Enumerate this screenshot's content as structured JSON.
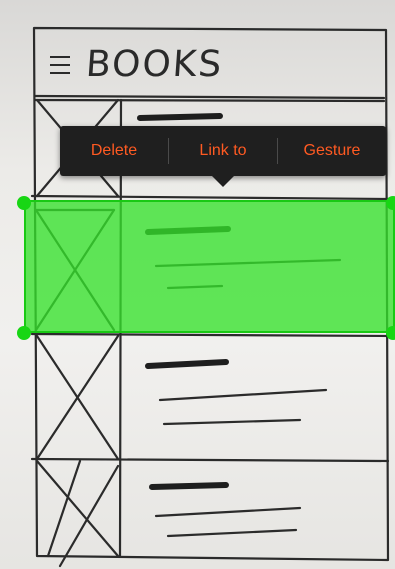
{
  "header": {
    "title": "BOOKS",
    "menu_icon": "hamburger-menu-icon"
  },
  "context_menu": {
    "items": [
      {
        "label": "Delete"
      },
      {
        "label": "Link to"
      },
      {
        "label": "Gesture"
      }
    ],
    "text_color": "#ff5a22",
    "background": "#1f1f1f"
  },
  "selection": {
    "color": "#36e22c",
    "handle_icon": "selection-handle-icon"
  },
  "list": {
    "rows": [
      {
        "image": "image-placeholder-icon"
      },
      {
        "image": "image-placeholder-icon"
      },
      {
        "image": "image-placeholder-icon"
      },
      {
        "image": "image-placeholder-icon"
      }
    ]
  }
}
